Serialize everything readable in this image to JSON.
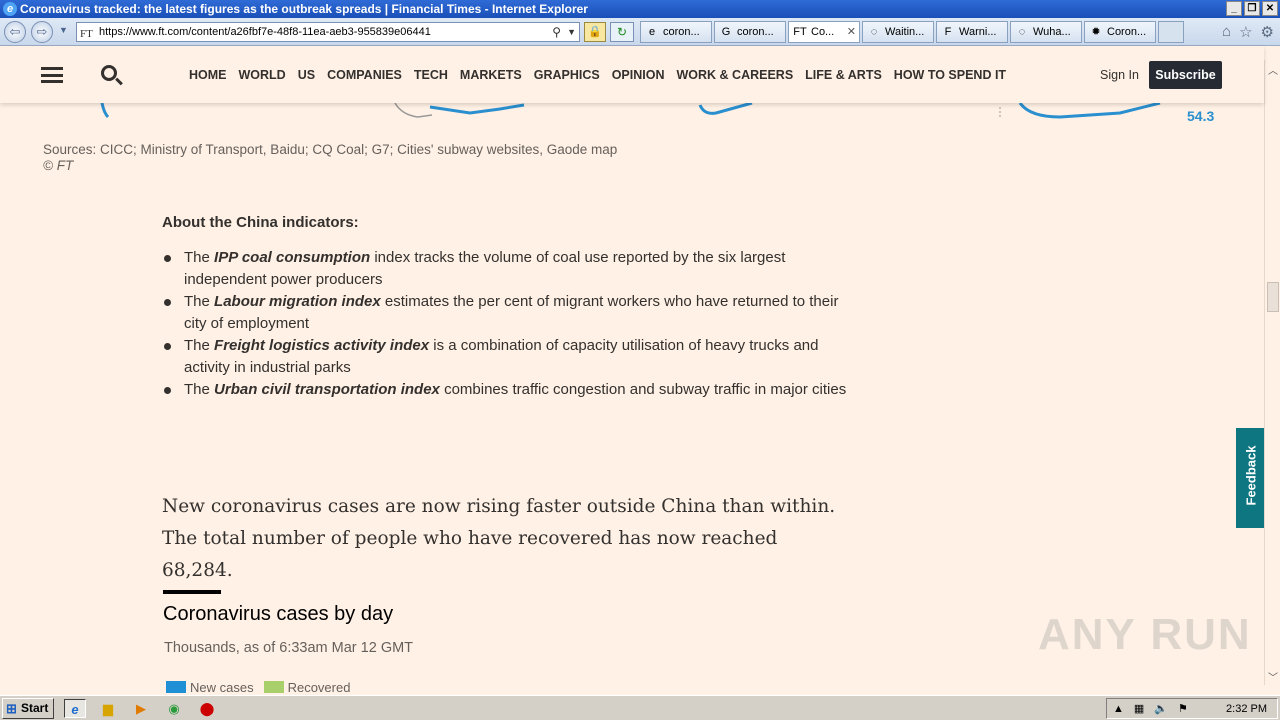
{
  "window": {
    "title": "Coronavirus tracked: the latest figures as the outbreak spreads | Financial Times - Internet Explorer",
    "url": "https://www.ft.com/content/a26fbf7e-48f8-11ea-aeb3-955839e06441",
    "favicon_text": "FT",
    "tabs": [
      {
        "label": "coron...",
        "icon": "ie-icon"
      },
      {
        "label": "coron...",
        "icon": "google-icon"
      },
      {
        "label": "Co...",
        "icon": "ft-icon",
        "active": true
      },
      {
        "label": "Waitin...",
        "icon": "loading-icon"
      },
      {
        "label": "Warni...",
        "icon": "f-icon"
      },
      {
        "label": "Wuha...",
        "icon": "loading-icon"
      },
      {
        "label": "Coron...",
        "icon": "virus-icon"
      }
    ]
  },
  "ft_header": {
    "nav": [
      "HOME",
      "WORLD",
      "US",
      "COMPANIES",
      "TECH",
      "MARKETS",
      "GRAPHICS",
      "OPINION",
      "WORK & CAREERS",
      "LIFE & ARTS",
      "HOW TO SPEND IT"
    ],
    "signin": "Sign In",
    "subscribe": "Subscribe"
  },
  "chart_remnant": {
    "value": "54.3",
    "color": "#2a8fcf"
  },
  "sources": {
    "text": "Sources: CICC; Ministry of Transport, Baidu; CQ Coal; G7; Cities' subway websites, Gaode map",
    "copyright": "© FT"
  },
  "indicators": {
    "heading": "About the China indicators:",
    "items": [
      {
        "prefix": "The",
        "name": "IPP coal consumption",
        "rest": "index tracks the volume of coal use reported by the six largest independent power producers"
      },
      {
        "prefix": "The",
        "name": "Labour migration index",
        "rest": "estimates the per cent of migrant workers who have returned to their city of employment"
      },
      {
        "prefix": "The",
        "name": "Freight logistics activity index",
        "rest": "is a combination of capacity utilisation of heavy trucks and activity in industrial parks"
      },
      {
        "prefix": "The",
        "name": "Urban civil transportation index",
        "rest": "combines traffic congestion and subway traffic in major cities"
      }
    ]
  },
  "paragraph": "New coronavirus cases are now rising faster outside China than within. The total number of people who have recovered has now reached 68,284.",
  "chart": {
    "title": "Coronavirus cases by day",
    "subtitle": "Thousands, as of 6:33am Mar 12 GMT",
    "legend": [
      {
        "label": "New cases",
        "color": "#1f8fd6"
      },
      {
        "label": "Recovered",
        "color": "#a8cf6a"
      }
    ]
  },
  "feedback": "Feedback",
  "watermark": "ANY RUN",
  "taskbar": {
    "start": "Start",
    "clock": "2:32 PM"
  }
}
